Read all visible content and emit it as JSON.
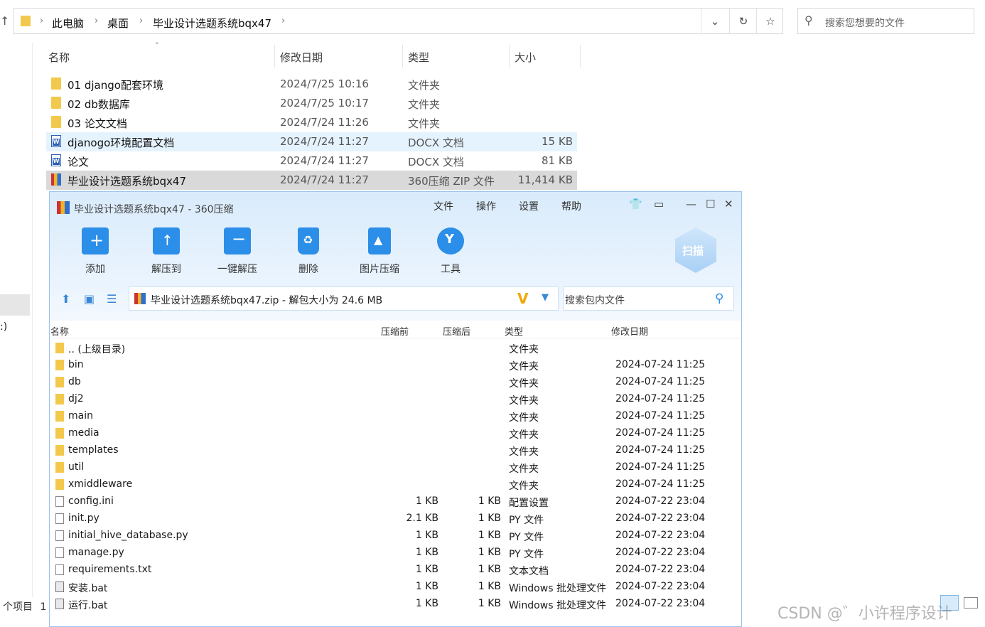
{
  "explorer": {
    "breadcrumb": [
      "此电脑",
      "桌面",
      "毕业设计选题系统bqx47"
    ],
    "search_placeholder": "搜索您想要的文件",
    "columns": {
      "name": "名称",
      "date": "修改日期",
      "type": "类型",
      "size": "大小"
    },
    "files": [
      {
        "name": "01 django配套环境",
        "date": "2024/7/25 10:16",
        "type": "文件夹",
        "size": "",
        "icon": "folder-icon"
      },
      {
        "name": "02 db数据库",
        "date": "2024/7/25 10:17",
        "type": "文件夹",
        "size": "",
        "icon": "folder-icon"
      },
      {
        "name": "03 论文文档",
        "date": "2024/7/24 11:26",
        "type": "文件夹",
        "size": "",
        "icon": "folder-icon"
      },
      {
        "name": "djanogo环境配置文档",
        "date": "2024/7/24 11:27",
        "type": "DOCX 文档",
        "size": "15 KB",
        "icon": "word-doc-icon"
      },
      {
        "name": "论文",
        "date": "2024/7/24 11:27",
        "type": "DOCX 文档",
        "size": "81 KB",
        "icon": "word-doc-icon"
      },
      {
        "name": "毕业设计选题系统bqx47",
        "date": "2024/7/24 11:27",
        "type": "360压缩 ZIP 文件",
        "size": "11,414 KB",
        "icon": "zip-archive-icon"
      }
    ],
    "status_text": "个项目",
    "status_count_partial": "1",
    "left_pane_text": ":)"
  },
  "archiver": {
    "title": "毕业设计选题系统bqx47 - 360压缩",
    "menu": [
      "文件",
      "操作",
      "设置",
      "帮助"
    ],
    "tools": [
      {
        "label": "添加",
        "icon": "add-icon",
        "color": "#2b8ee8"
      },
      {
        "label": "解压到",
        "icon": "extract-to-icon",
        "color": "#2b8ee8"
      },
      {
        "label": "一键解压",
        "icon": "one-click-extract-icon",
        "color": "#2b8ee8"
      },
      {
        "label": "删除",
        "icon": "recycle-bin-icon",
        "color": "#2b8ee8"
      },
      {
        "label": "图片压缩",
        "icon": "image-compress-icon",
        "color": "#2b8ee8"
      },
      {
        "label": "工具",
        "icon": "tools-icon",
        "color": "#2b8ee8"
      }
    ],
    "scan_label": "扫描",
    "path_text": "毕业设计选题系统bqx47.zip - 解包大小为 24.6 MB",
    "search_placeholder": "搜索包内文件",
    "columns": {
      "name": "名称",
      "before": "压缩前",
      "after": "压缩后",
      "type": "类型",
      "date": "修改日期"
    },
    "entries": [
      {
        "name": ".. (上级目录)",
        "before": "",
        "after": "",
        "type": "文件夹",
        "date": "",
        "icon": "folder-icon"
      },
      {
        "name": "bin",
        "before": "",
        "after": "",
        "type": "文件夹",
        "date": "2024-07-24 11:25",
        "icon": "folder-icon"
      },
      {
        "name": "db",
        "before": "",
        "after": "",
        "type": "文件夹",
        "date": "2024-07-24 11:25",
        "icon": "folder-icon"
      },
      {
        "name": "dj2",
        "before": "",
        "after": "",
        "type": "文件夹",
        "date": "2024-07-24 11:25",
        "icon": "folder-icon"
      },
      {
        "name": "main",
        "before": "",
        "after": "",
        "type": "文件夹",
        "date": "2024-07-24 11:25",
        "icon": "folder-icon"
      },
      {
        "name": "media",
        "before": "",
        "after": "",
        "type": "文件夹",
        "date": "2024-07-24 11:25",
        "icon": "folder-icon"
      },
      {
        "name": "templates",
        "before": "",
        "after": "",
        "type": "文件夹",
        "date": "2024-07-24 11:25",
        "icon": "folder-icon"
      },
      {
        "name": "util",
        "before": "",
        "after": "",
        "type": "文件夹",
        "date": "2024-07-24 11:25",
        "icon": "folder-icon"
      },
      {
        "name": "xmiddleware",
        "before": "",
        "after": "",
        "type": "文件夹",
        "date": "2024-07-24 11:25",
        "icon": "folder-icon"
      },
      {
        "name": "config.ini",
        "before": "1 KB",
        "after": "1 KB",
        "type": "配置设置",
        "date": "2024-07-22 23:04",
        "icon": "config-file-icon"
      },
      {
        "name": "init.py",
        "before": "2.1 KB",
        "after": "1 KB",
        "type": "PY 文件",
        "date": "2024-07-22 23:04",
        "icon": "file-icon"
      },
      {
        "name": "initial_hive_database.py",
        "before": "1 KB",
        "after": "1 KB",
        "type": "PY 文件",
        "date": "2024-07-22 23:04",
        "icon": "file-icon"
      },
      {
        "name": "manage.py",
        "before": "1 KB",
        "after": "1 KB",
        "type": "PY 文件",
        "date": "2024-07-22 23:04",
        "icon": "file-icon"
      },
      {
        "name": "requirements.txt",
        "before": "1 KB",
        "after": "1 KB",
        "type": "文本文档",
        "date": "2024-07-22 23:04",
        "icon": "text-file-icon"
      },
      {
        "name": "安装.bat",
        "before": "1 KB",
        "after": "1 KB",
        "type": "Windows 批处理文件",
        "date": "2024-07-22 23:04",
        "icon": "batch-file-icon"
      },
      {
        "name": "运行.bat",
        "before": "1 KB",
        "after": "1 KB",
        "type": "Windows 批处理文件",
        "date": "2024-07-22 23:04",
        "icon": "batch-file-icon"
      }
    ]
  },
  "watermark": "CSDN @゛小许程序设计"
}
